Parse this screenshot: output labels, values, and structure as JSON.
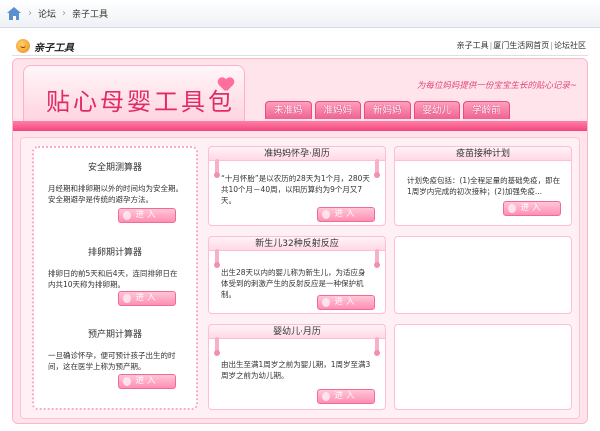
{
  "breadcrumb": {
    "items": [
      "论坛",
      "亲子工具"
    ],
    "separator": "›"
  },
  "header": {
    "logo_text": "亲子工具",
    "links": [
      "亲子工具",
      "厦门生活网首页",
      "论坛社区"
    ]
  },
  "banner": {
    "title": "贴心母婴工具包",
    "slogan": "为每位妈妈提供一份宝宝生长的贴心记录~"
  },
  "tabs": [
    "未准妈",
    "准妈妈",
    "新妈妈",
    "婴幼儿",
    "学龄前"
  ],
  "enter_label": "进入",
  "tools": [
    {
      "title": "安全期测算器",
      "desc": "月经期和排卵期以外的时间均为安全期。安全期避孕是传统的避孕方法。"
    },
    {
      "title": "排卵期计算器",
      "desc": "排卵日的前5天和后4天，连同排卵日在内共10天称为排卵期。"
    },
    {
      "title": "预产期计算器",
      "desc": "一旦确诊怀孕，便可预计孩子出生的时间，这在医学上称为预产期。"
    }
  ],
  "cards": [
    {
      "title": "准妈妈怀孕·周历",
      "desc": "“十月怀胎”是以农历的28天为1个月，280天共10个月－40周，以阳历算约为9个月又7天。"
    },
    {
      "title": "新生儿32种反射反应",
      "desc": "出生28天以内的婴儿称为新生儿，为适应身体受到的刺激产生的反射反应是一种保护机制。"
    },
    {
      "title": "婴幼儿·月历",
      "desc": "由出生至满1周岁之前为婴儿期，1周岁至满3周岁之前为幼儿期。"
    }
  ],
  "vaccine": {
    "title": "疫苗接种计划",
    "desc": "计划免疫包括：(1)全程足量的基础免疫，即在1周岁内完成的初次接种；(2)加强免疫..."
  },
  "colors": {
    "accent": "#f06292",
    "title": "#e02b66",
    "frame": "#ffe4ec"
  }
}
